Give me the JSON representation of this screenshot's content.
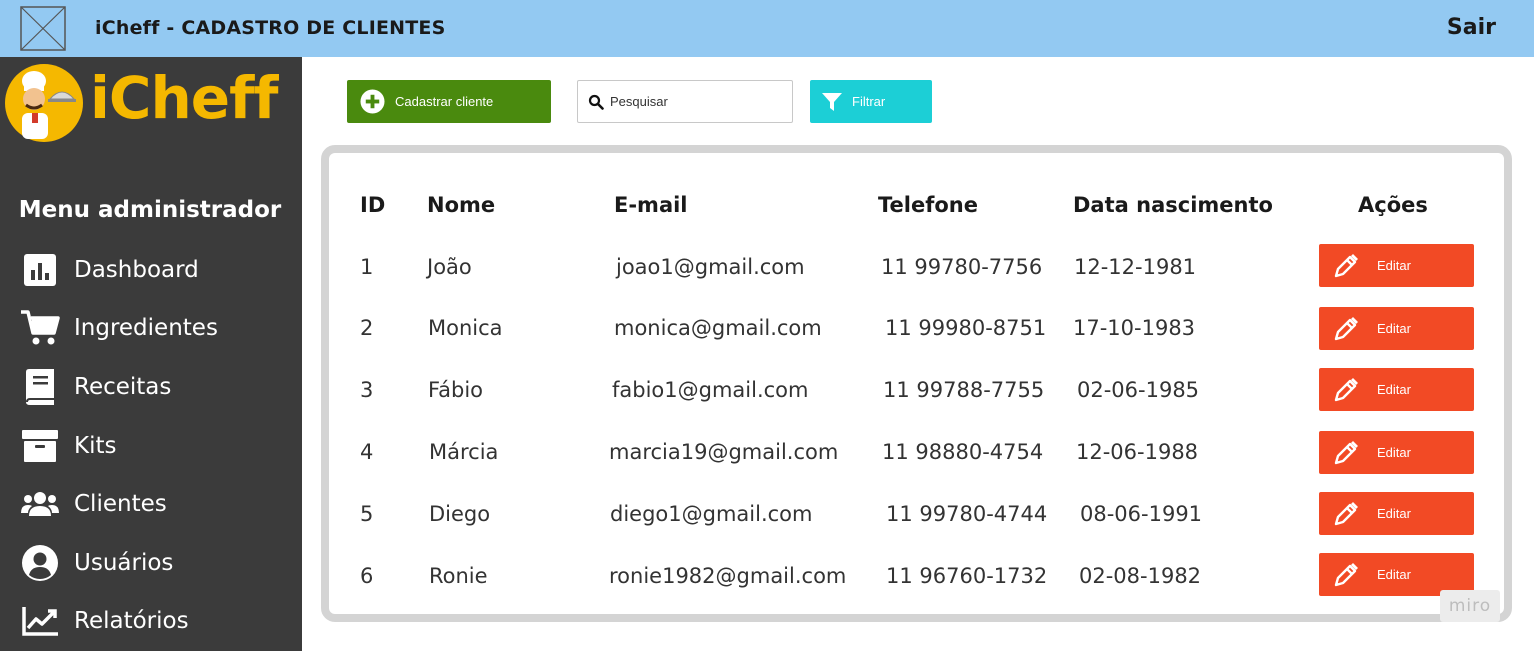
{
  "header": {
    "title": "iCheff - CADASTRO DE CLIENTES",
    "logout_label": "Sair"
  },
  "sidebar": {
    "brand": "iCheff",
    "menu_title": "Menu administrador",
    "items": [
      {
        "label": "Dashboard",
        "icon": "chart-bars-icon"
      },
      {
        "label": "Ingredientes",
        "icon": "cart-icon"
      },
      {
        "label": "Receitas",
        "icon": "book-icon"
      },
      {
        "label": "Kits",
        "icon": "archive-box-icon"
      },
      {
        "label": "Clientes",
        "icon": "users-icon"
      },
      {
        "label": "Usuários",
        "icon": "user-circle-icon"
      },
      {
        "label": "Relatórios",
        "icon": "line-chart-icon"
      }
    ]
  },
  "toolbar": {
    "add_label": "Cadastrar cliente",
    "search_placeholder": "Pesquisar",
    "filter_label": "Filtrar"
  },
  "table": {
    "headers": {
      "id": "ID",
      "name": "Nome",
      "email": "E-mail",
      "phone": "Telefone",
      "birth": "Data nascimento",
      "actions": "Ações"
    },
    "edit_label": "Editar",
    "rows": [
      {
        "id": "1",
        "name": "João",
        "email": "joao1@gmail.com",
        "phone": "11 99780-7756",
        "birth": "12-12-1981"
      },
      {
        "id": "2",
        "name": "Monica",
        "email": "monica@gmail.com",
        "phone": "11 99980-8751",
        "birth": "17-10-1983"
      },
      {
        "id": "3",
        "name": "Fábio",
        "email": "fabio1@gmail.com",
        "phone": "11 99788-7755",
        "birth": "02-06-1985"
      },
      {
        "id": "4",
        "name": "Márcia",
        "email": "marcia19@gmail.com",
        "phone": "11 98880-4754",
        "birth": "12-06-1988"
      },
      {
        "id": "5",
        "name": "Diego",
        "email": "diego1@gmail.com",
        "phone": "11 99780-4744",
        "birth": "08-06-1991"
      },
      {
        "id": "6",
        "name": "Ronie",
        "email": "ronie1982@gmail.com",
        "phone": "11 96760-1732",
        "birth": "02-08-1982"
      }
    ]
  },
  "watermark": "miro",
  "colors": {
    "topbar": "#93c9f2",
    "sidebar": "#3b3b3b",
    "brand": "#f5b800",
    "add_button": "#4a8a0e",
    "filter_button": "#1ccfd6",
    "edit_button": "#f24a25"
  }
}
